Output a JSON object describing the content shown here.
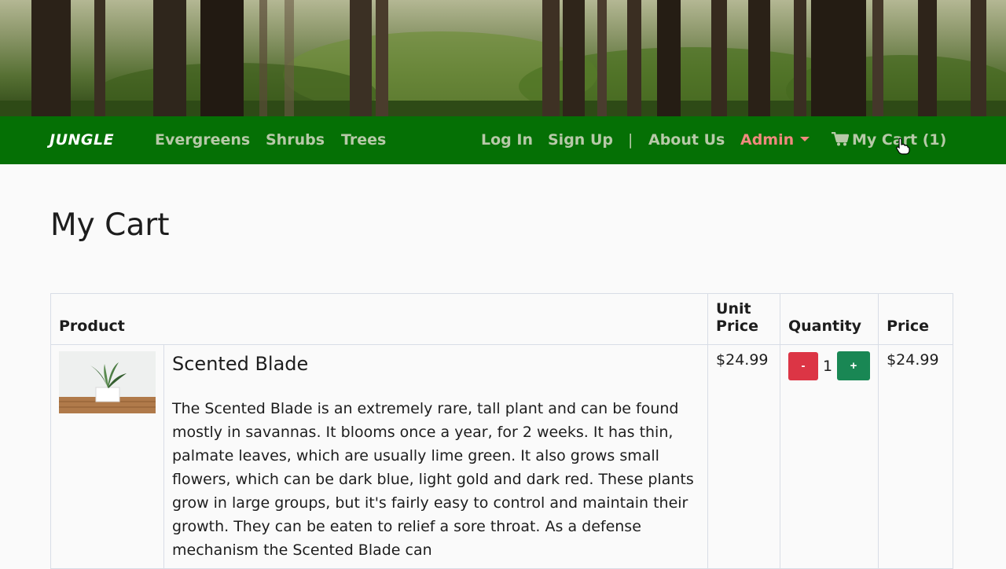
{
  "nav": {
    "brand": "JUNGLE",
    "links": [
      "Evergreens",
      "Shrubs",
      "Trees"
    ],
    "login": "Log In",
    "signup": "Sign Up",
    "separator": "|",
    "about": "About Us",
    "admin": "Admin",
    "cart": "My Cart (1)"
  },
  "colors": {
    "navbar": "#057005",
    "admin": "#f08a7e",
    "minus_button": "#dc3545",
    "plus_button": "#198754"
  },
  "page": {
    "title": "My Cart"
  },
  "table": {
    "headers": {
      "product": "Product",
      "unit_price": "Unit Price",
      "quantity": "Quantity",
      "price": "Price"
    },
    "rows": [
      {
        "name": "Scented Blade",
        "description": "The Scented Blade is an extremely rare, tall plant and can be found mostly in savannas. It blooms once a year, for 2 weeks. It has thin, palmate leaves, which are usually lime green. It also grows small flowers, which can be dark blue, light gold and dark red. These plants grow in large groups, but it's fairly easy to control and maintain their growth. They can be eaten to relief a sore throat. As a defense mechanism the Scented Blade can",
        "unit_price": "$24.99",
        "minus_label": "-",
        "quantity": "1",
        "plus_label": "+",
        "price": "$24.99"
      }
    ]
  }
}
